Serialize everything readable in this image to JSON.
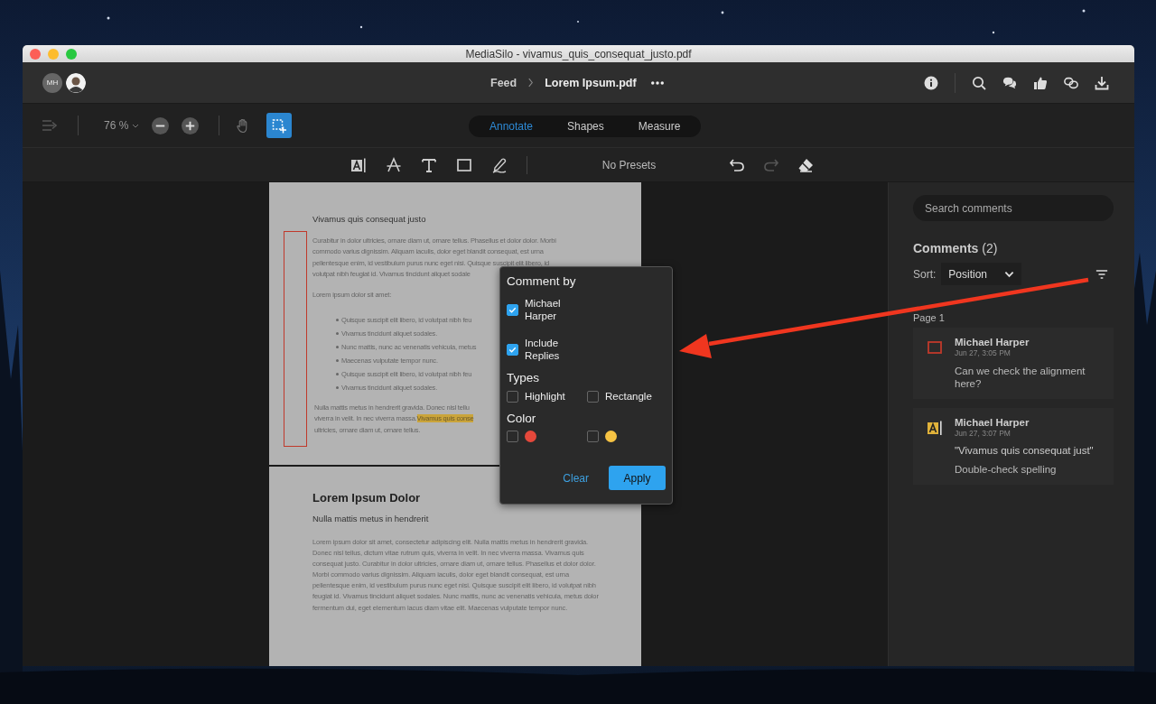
{
  "window": {
    "title": "MediaSilo - vivamus_quis_consequat_justo.pdf"
  },
  "header": {
    "avatars": [
      {
        "kind": "initials",
        "text": "MH"
      },
      {
        "kind": "picture"
      }
    ],
    "breadcrumb": [
      "Feed",
      "Lorem Ipsum.pdf"
    ]
  },
  "toolbar": {
    "zoom": "76 %",
    "tools": [
      {
        "kind": "pan",
        "selected": false
      },
      {
        "kind": "select",
        "selected": true
      }
    ],
    "modes": [
      {
        "label": "Annotate",
        "selected": true
      },
      {
        "label": "Shapes",
        "selected": false
      },
      {
        "label": "Measure",
        "selected": false
      }
    ]
  },
  "annotation_bar": {
    "presets": "No Presets",
    "history": [
      {
        "kind": "undo",
        "disabled": false
      },
      {
        "kind": "redo",
        "disabled": true
      }
    ]
  },
  "document": {
    "page_1": {
      "title": "Vivamus quis consequat justo",
      "lines": [
        {
          "text": "Curabitur in dolor ultricies, ornare diam ut, ornare tellus. Phasellus et dolor dolor. Morbi"
        },
        {
          "text": "commodo varius dignissim. Aliquam iaculis, dolor eget blandit consequat, est urna"
        },
        {
          "text": "pellentesque enim, id vestibulum purus nunc eget nisi. Quisque suscipit elit libero, id"
        },
        {
          "text": "volutpat nibh feugiat id. Vivamus tincidunt aliquet sodale"
        }
      ],
      "intro": "Lorem ipsum dolor sit amet:",
      "bullets": [
        "Quisque suscipit elit libero, id volutpat nibh feu",
        "Vivamus tincidunt aliquet sodales.",
        "Nunc mattis, nunc ac venenatis vehicula, metus",
        "Maecenas vulputate tempor nunc.",
        "Quisque suscipit elit libero, id volutpat nibh feu",
        "Vivamus tincidunt aliquet sodales."
      ],
      "closing": [
        {
          "text": "Nulla mattis metus in hendrerit gravida. Donec nisl tellu"
        },
        {
          "text": "viverra in velit. In nec viverra massa.",
          "highlight": "Vivamus quis conse"
        },
        {
          "text": "ultricies, ornare diam ut, ornare tellus."
        }
      ]
    },
    "page_2": {
      "heading": "Lorem Ipsum Dolor",
      "subheading": "Nulla mattis metus in hendrerit",
      "paragraph": "Lorem ipsum dolor sit amet, consectetur adipiscing elit. Nulla mattis metus in hendrerit gravida. Donec nisl tellus, dictum vitae rutrum quis, viverra in velit. In nec viverra massa. Vivamus quis consequat justo. Curabitur in dolor ultricies, ornare diam ut, ornare tellus. Phasellus et dolor dolor. Morbi commodo varius dignissim. Aliquam iaculis, dolor eget blandit consequat, est urna pellentesque enim, id vestibulum purus nunc eget nisi. Quisque suscipit elit libero, id volutpat nibh feugiat id. Vivamus tincidunt aliquet sodales. Nunc mattis, nunc ac venenatis vehicula, metus dolor fermentum dui, eget elementum lacus diam vitae elit. Maecenas vulputate tempor nunc."
    }
  },
  "filter_popup": {
    "title": "Comment by",
    "authors": [
      {
        "label": "Michael Harper",
        "checked": true
      },
      {
        "label": "Include Replies",
        "checked": true
      }
    ],
    "types_title": "Types",
    "types": [
      {
        "label": "Highlight",
        "checked": false
      },
      {
        "label": "Rectangle",
        "checked": false
      }
    ],
    "color_title": "Color",
    "colors": [
      {
        "color": "#e5483b",
        "checked": false
      },
      {
        "color": "#f6c343",
        "checked": false
      }
    ],
    "clear": "Clear",
    "apply": "Apply"
  },
  "sidebar": {
    "search": {
      "placeholder": "Search comments"
    },
    "heading": "Comments",
    "count": "(2)",
    "sort_label": "Sort:",
    "sort_value": "Position",
    "group": "Page 1",
    "comments": [
      {
        "kind": "rectangle",
        "author": "Michael Harper",
        "time": "Jun 27, 3:05 PM",
        "text": "Can we check the alignment here?"
      },
      {
        "kind": "highlight",
        "author": "Michael Harper",
        "time": "Jun 27, 3:07 PM",
        "quote": "\"Vivamus quis consequat just\"",
        "text": "Double-check spelling"
      }
    ]
  }
}
